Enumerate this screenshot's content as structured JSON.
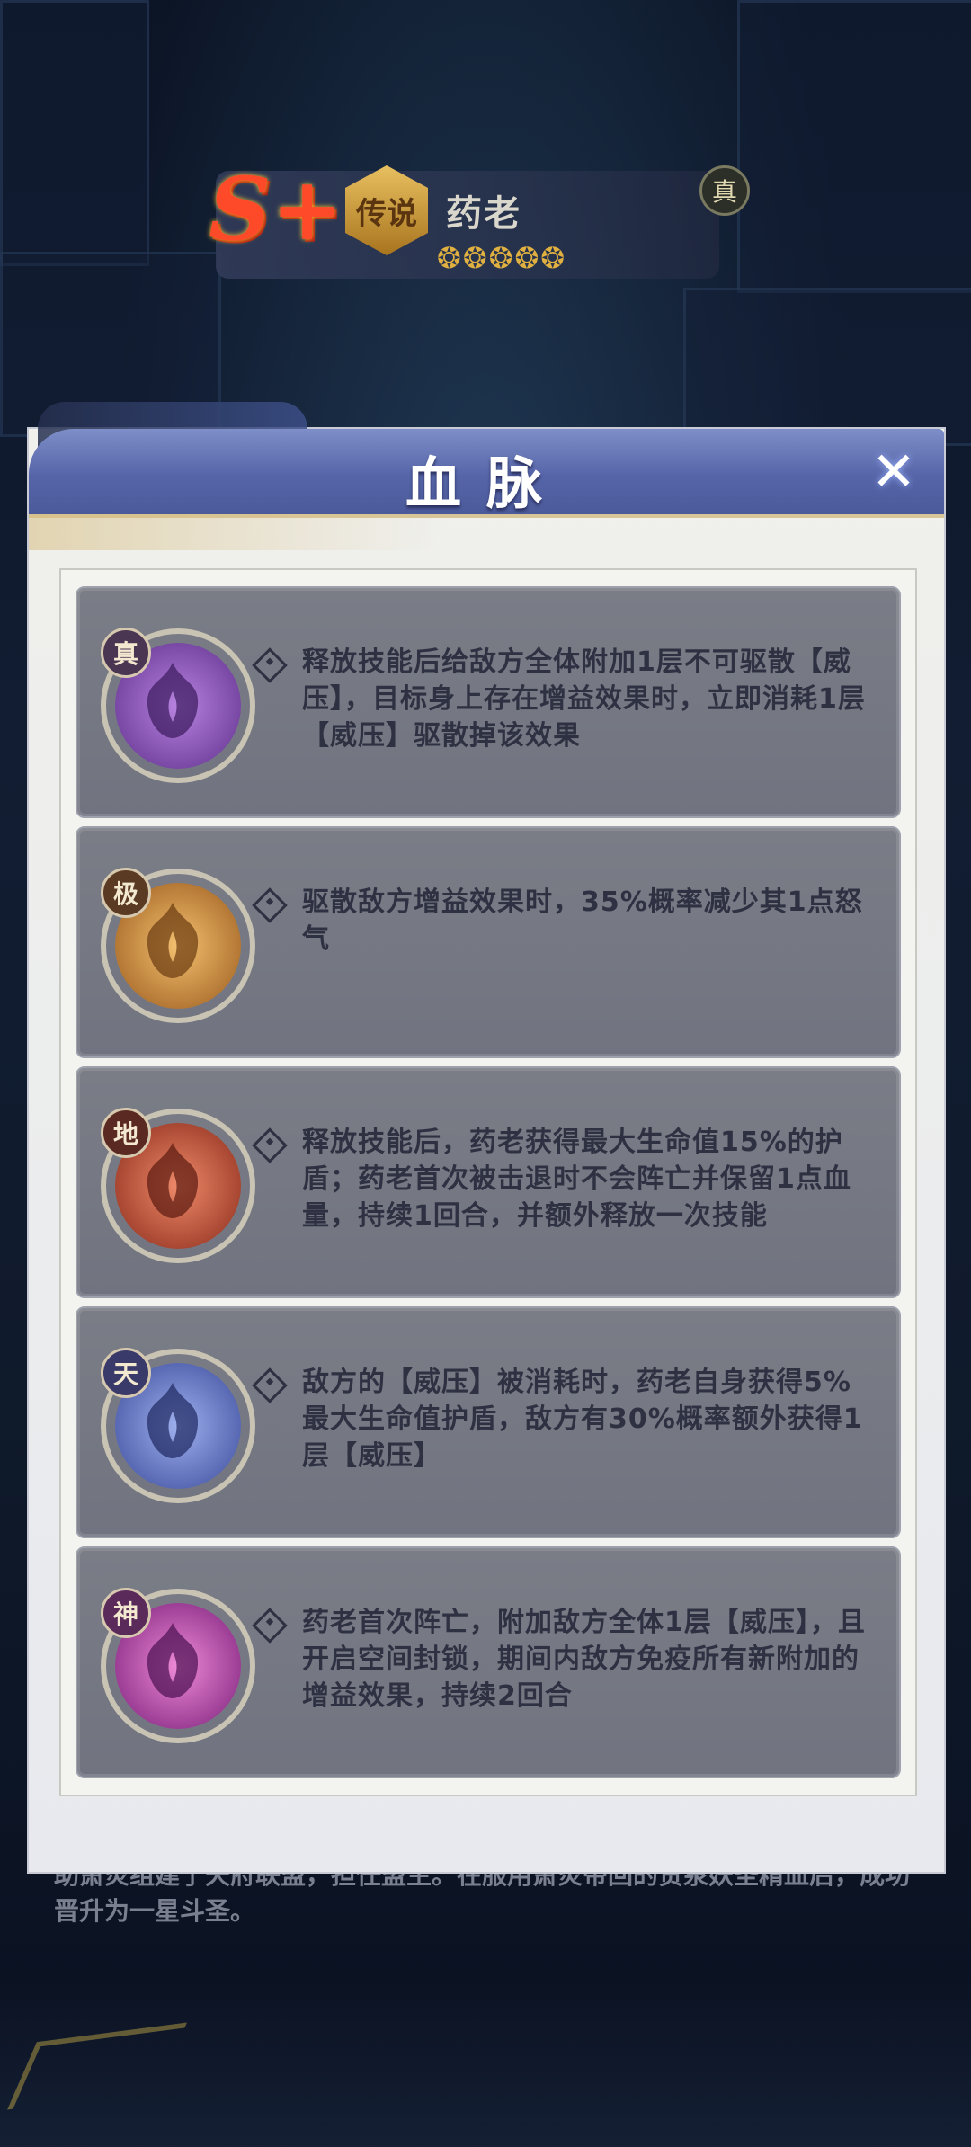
{
  "hero": {
    "grade": "S+",
    "rarity": "传说",
    "name": "药老",
    "stars": "❂❂❂❂❂",
    "badge": "真",
    "description": "助萧炎组建了天府联盟，担任盟主。在服用萧炎带回的贵泉妖圣精血后，成功晋升为一星斗圣。"
  },
  "modal": {
    "title": "血脉",
    "close_icon": "close-icon"
  },
  "bloodlines": [
    {
      "tier": "真",
      "emblem": "purple-flame-emblem",
      "color": "#8a4fb0",
      "text": "释放技能后给敌方全体附加1层不可驱散【威压】，目标身上存在增益效果时，立即消耗1层【威压】驱散掉该效果"
    },
    {
      "tier": "极",
      "emblem": "amber-flame-emblem",
      "color": "#c98a3a",
      "text": "驱散敌方增益效果时，35%概率减少其1点怒气"
    },
    {
      "tier": "地",
      "emblem": "red-flame-emblem",
      "color": "#c0523a",
      "text": "释放技能后，药老获得最大生命值15%的护盾；药老首次被击退时不会阵亡并保留1点血量，持续1回合，并额外释放一次技能"
    },
    {
      "tier": "天",
      "emblem": "blue-flame-emblem",
      "color": "#6a78c0",
      "text": "敌方的【威压】被消耗时，药老自身获得5%最大生命值护盾，敌方有30%概率额外获得1层【威压】"
    },
    {
      "tier": "神",
      "emblem": "magenta-flame-emblem",
      "color": "#c04aa8",
      "text": "药老首次阵亡，附加敌方全体1层【威压】，且开启空间封锁，期间内敌方免疫所有新附加的增益效果，持续2回合"
    }
  ]
}
